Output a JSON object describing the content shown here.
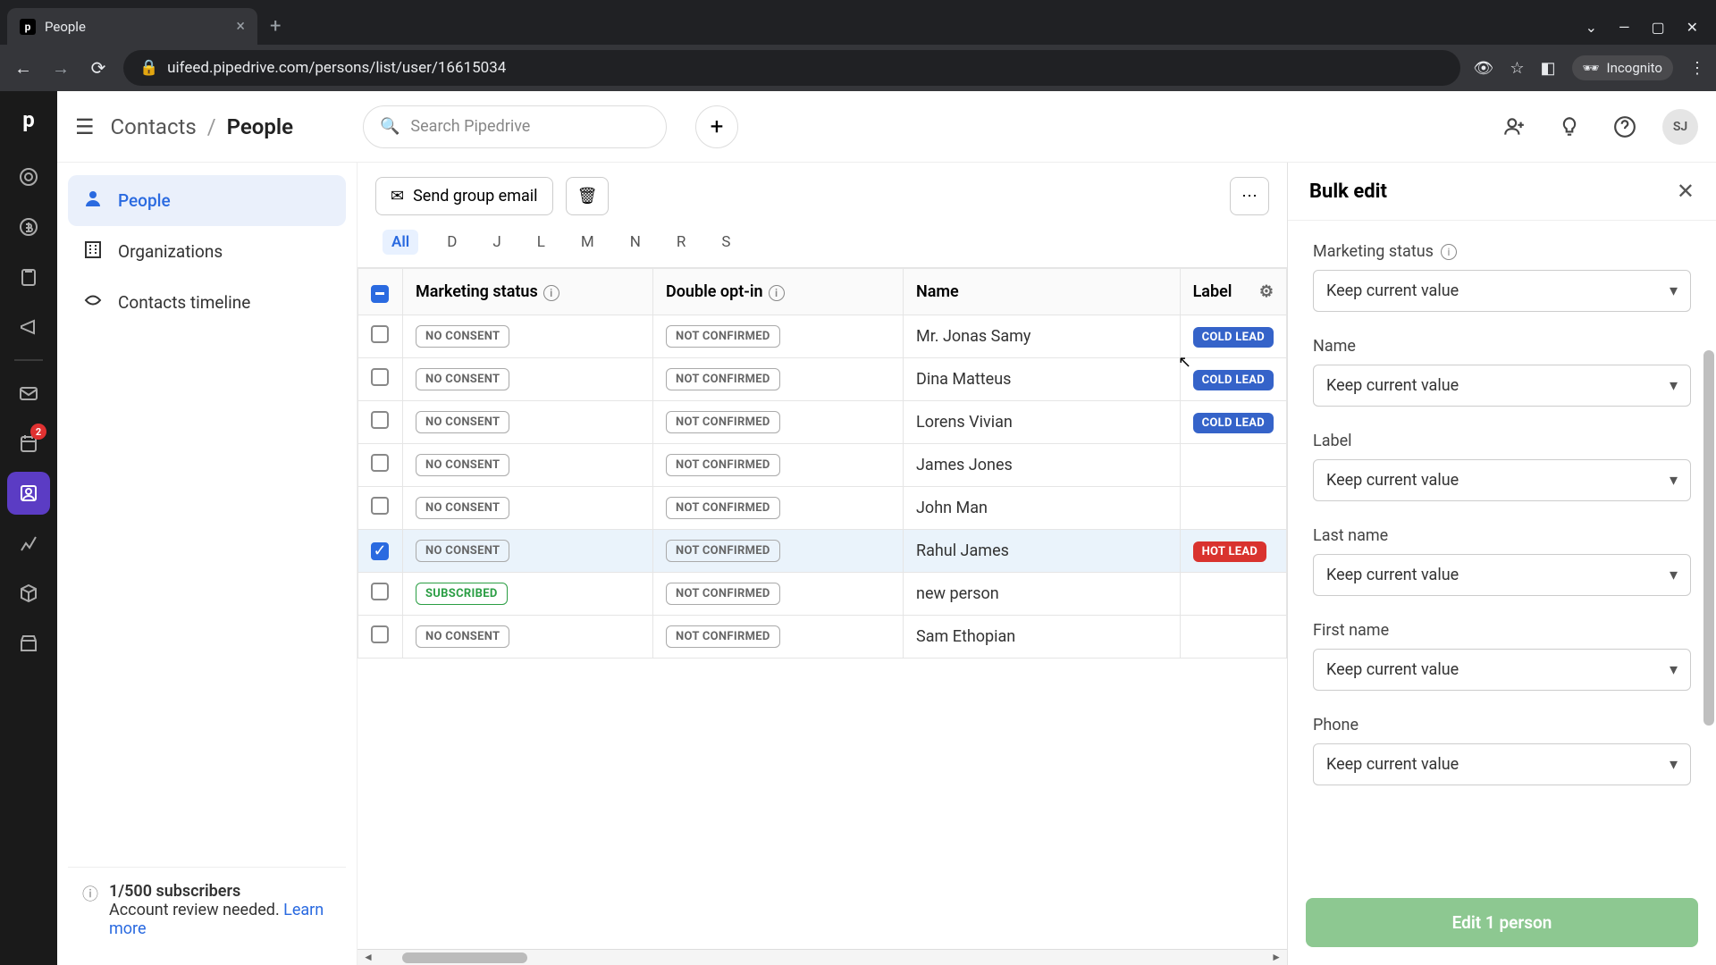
{
  "browser": {
    "tab_title": "People",
    "url": "uifeed.pipedrive.com/persons/list/user/16615034",
    "incognito_label": "Incognito"
  },
  "header": {
    "breadcrumb_root": "Contacts",
    "breadcrumb_current": "People",
    "search_placeholder": "Search Pipedrive",
    "avatar_initials": "SJ"
  },
  "rail": {
    "badge_count": "2"
  },
  "sidebar": {
    "items": [
      {
        "label": "People",
        "active": true
      },
      {
        "label": "Organizations",
        "active": false
      },
      {
        "label": "Contacts timeline",
        "active": false
      }
    ],
    "footer_title": "1/500 subscribers",
    "footer_text": "Account review needed.",
    "footer_link": "Learn more"
  },
  "toolbar": {
    "send_email_label": "Send group email",
    "alpha": [
      "All",
      "D",
      "J",
      "L",
      "M",
      "N",
      "R",
      "S"
    ],
    "alpha_active": "All"
  },
  "table": {
    "columns": [
      "Marketing status",
      "Double opt-in",
      "Name",
      "Label"
    ],
    "rows": [
      {
        "status": "NO CONSENT",
        "status_style": "gray",
        "optin": "NOT CONFIRMED",
        "name": "Mr. Jonas Samy",
        "label": "COLD LEAD",
        "label_style": "blue-fill",
        "checked": false
      },
      {
        "status": "NO CONSENT",
        "status_style": "gray",
        "optin": "NOT CONFIRMED",
        "name": "Dina Matteus",
        "label": "COLD LEAD",
        "label_style": "blue-fill",
        "checked": false
      },
      {
        "status": "NO CONSENT",
        "status_style": "gray",
        "optin": "NOT CONFIRMED",
        "name": "Lorens Vivian",
        "label": "COLD LEAD",
        "label_style": "blue-fill",
        "checked": false
      },
      {
        "status": "NO CONSENT",
        "status_style": "gray",
        "optin": "NOT CONFIRMED",
        "name": "James Jones",
        "label": "",
        "label_style": "",
        "checked": false
      },
      {
        "status": "NO CONSENT",
        "status_style": "gray",
        "optin": "NOT CONFIRMED",
        "name": "John Man",
        "label": "",
        "label_style": "",
        "checked": false
      },
      {
        "status": "NO CONSENT",
        "status_style": "gray",
        "optin": "NOT CONFIRMED",
        "name": "Rahul James",
        "label": "HOT LEAD",
        "label_style": "red-fill",
        "checked": true
      },
      {
        "status": "SUBSCRIBED",
        "status_style": "green",
        "optin": "NOT CONFIRMED",
        "name": "new person",
        "label": "",
        "label_style": "",
        "checked": false
      },
      {
        "status": "NO CONSENT",
        "status_style": "gray",
        "optin": "NOT CONFIRMED",
        "name": "Sam Ethopian",
        "label": "",
        "label_style": "",
        "checked": false
      }
    ]
  },
  "panel": {
    "title": "Bulk edit",
    "keep_value": "Keep current value",
    "fields": [
      {
        "label": "Marketing status",
        "has_info": true
      },
      {
        "label": "Name",
        "has_info": false
      },
      {
        "label": "Label",
        "has_info": false
      },
      {
        "label": "Last name",
        "has_info": false
      },
      {
        "label": "First name",
        "has_info": false
      },
      {
        "label": "Phone",
        "has_info": false
      }
    ],
    "submit_label": "Edit 1 person"
  }
}
